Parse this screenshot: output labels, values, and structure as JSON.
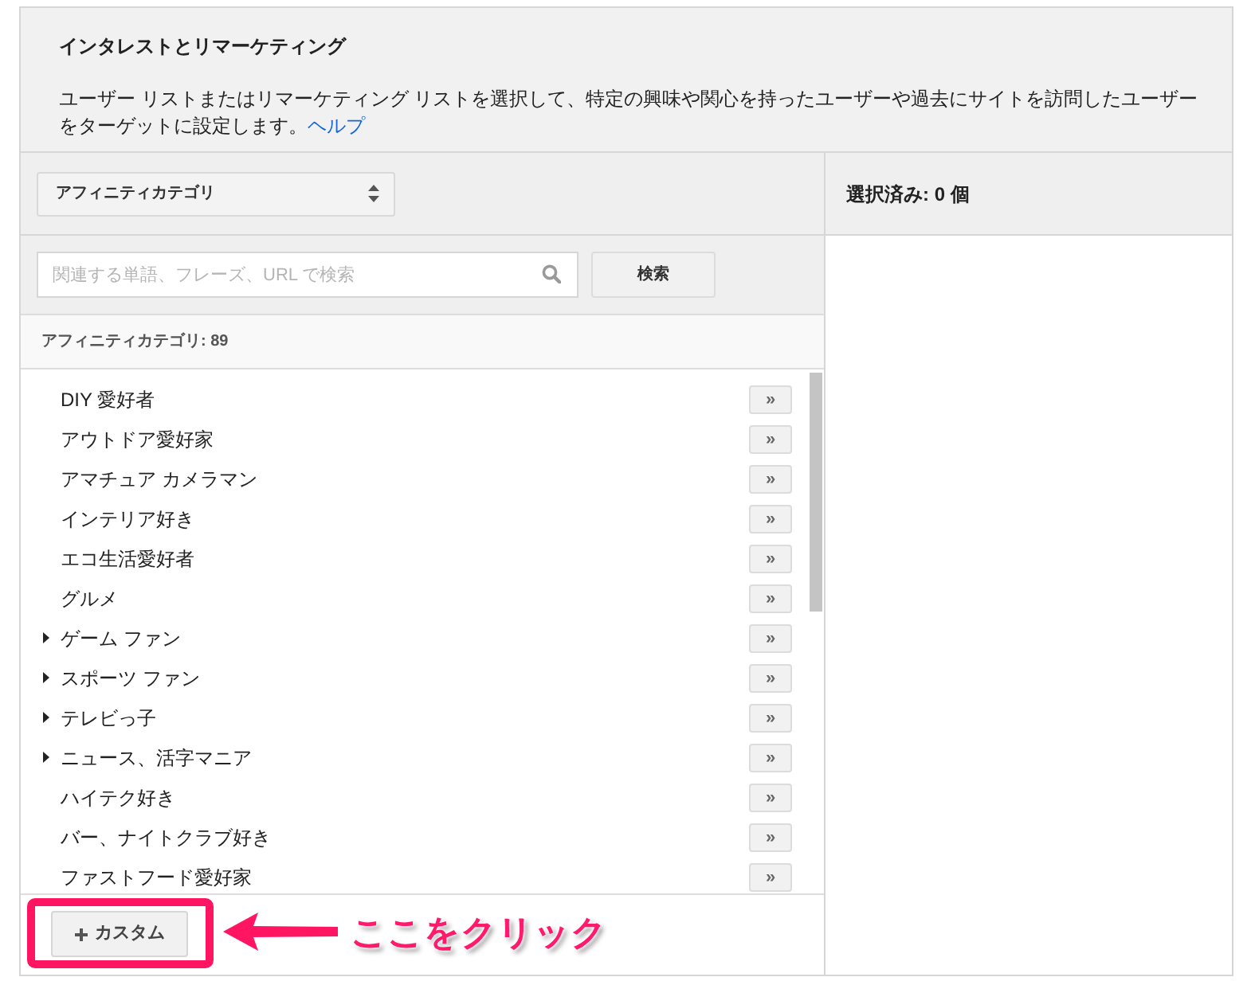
{
  "header": {
    "title": "インタレストとリマーケティング",
    "description": "ユーザー リストまたはリマーケティング リストを選択して、特定の興味や関心を持ったユーザーや過去にサイトを訪問したユーザーをターゲットに設定します。",
    "help_link": "ヘルプ"
  },
  "category_select": {
    "value": "アフィニティカテゴリ"
  },
  "search": {
    "placeholder": "関連する単語、フレーズ、URL で検索",
    "button": "検索"
  },
  "list": {
    "count_label": "アフィニティカテゴリ: 89",
    "items": [
      {
        "label": "DIY 愛好者",
        "expandable": false,
        "add_button": "»"
      },
      {
        "label": "アウトドア愛好家",
        "expandable": false,
        "add_button": "»"
      },
      {
        "label": "アマチュア カメラマン",
        "expandable": false,
        "add_button": "»"
      },
      {
        "label": "インテリア好き",
        "expandable": false,
        "add_button": "»"
      },
      {
        "label": "エコ生活愛好者",
        "expandable": false,
        "add_button": "»"
      },
      {
        "label": "グルメ",
        "expandable": false,
        "add_button": "»"
      },
      {
        "label": "ゲーム ファン",
        "expandable": true,
        "add_button": "»"
      },
      {
        "label": "スポーツ ファン",
        "expandable": true,
        "add_button": "»"
      },
      {
        "label": "テレビっ子",
        "expandable": true,
        "add_button": "»"
      },
      {
        "label": "ニュース、活字マニア",
        "expandable": true,
        "add_button": "»"
      },
      {
        "label": "ハイテク好き",
        "expandable": false,
        "add_button": "»"
      },
      {
        "label": "バー、ナイトクラブ好き",
        "expandable": false,
        "add_button": "»"
      },
      {
        "label": "ファストフード愛好家",
        "expandable": false,
        "add_button": "»"
      }
    ]
  },
  "custom_button": {
    "label": "カスタム"
  },
  "selected_panel": {
    "title": "選択済み: 0 個"
  },
  "annotation": {
    "text": "ここをクリック"
  }
}
